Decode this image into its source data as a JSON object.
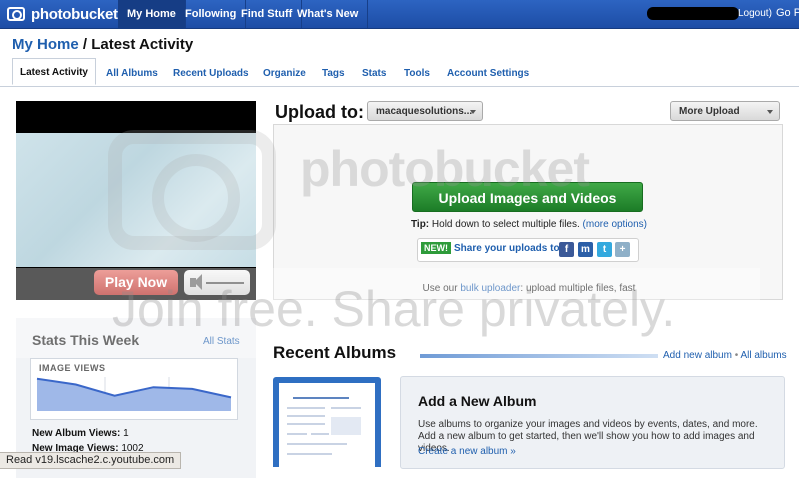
{
  "topbar": {
    "logo_text": "photobucket",
    "tabs": [
      "My Home",
      "Following",
      "Find Stuff",
      "What's New"
    ],
    "logout": "Logout)",
    "go_pro": "Go Pr"
  },
  "page": {
    "title_home": "My Home",
    "title_rest": " / Latest Activity"
  },
  "subtabs": [
    "Latest Activity",
    "All Albums",
    "Recent Uploads",
    "Organize",
    "Tags",
    "Stats",
    "Tools",
    "Account Settings"
  ],
  "video": {
    "play_label": "Play Now"
  },
  "stats": {
    "title": "Stats This Week",
    "all_link": "All Stats",
    "graph_label": "IMAGE VIEWS",
    "graph_values": [
      0.95,
      0.78,
      0.45,
      0.7,
      0.65,
      0.4
    ],
    "album_views_label": "New Album Views:",
    "album_views_value": "1",
    "image_views_label": "New Image Views:",
    "image_views_value": "1002"
  },
  "upload": {
    "label": "Upload to:",
    "album": "macaquesolutions...",
    "more_tools": "More Upload Tools",
    "button": "Upload Images and Videos",
    "tip_label": "Tip:",
    "tip_text": " Hold down to select multiple files. ",
    "more_options": "(more options)",
    "new_badge": "NEW!",
    "share_label": "Share your uploads to:",
    "bulk_prefix": "Use our ",
    "bulk_link": "bulk uploader",
    "bulk_suffix": ": upload multiple files, fast"
  },
  "recent_albums": {
    "title": "Recent Albums",
    "add_link": "Add new album",
    "sep": " • ",
    "all_link": "All albums",
    "card_title": "Add a New Album",
    "card_desc": "Use albums to organize your images and videos by events, dates, and more. Add a new album to get started, then we'll show you how to add images and videos.",
    "card_link": "Create a new album »"
  },
  "watermark": {
    "brand": "photobucket",
    "join": "Join free. Share privately."
  },
  "status": {
    "text": "Read v19.lscache2.c.youtube.com"
  },
  "colors": {
    "brand_blue": "#1d4da6",
    "link": "#1f5fae",
    "upload_green": "#2e9b3a",
    "play_red": "#c0342d"
  }
}
